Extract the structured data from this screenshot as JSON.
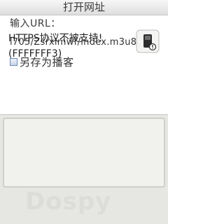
{
  "title_bar": {
    "title": "打开网址"
  },
  "form": {
    "url_label": "输入URL：",
    "url_value": "l705/Zsrxlmwf/index.m3u8",
    "save_as_podcast_label": "另存为播客",
    "save_as_podcast_checked": false
  },
  "dialog": {
    "message": "HTTPS协议不被支持!\n(FFFFFFF3)",
    "icon": "phone-warning-icon"
  },
  "watermark": {
    "text": "Dospy"
  }
}
